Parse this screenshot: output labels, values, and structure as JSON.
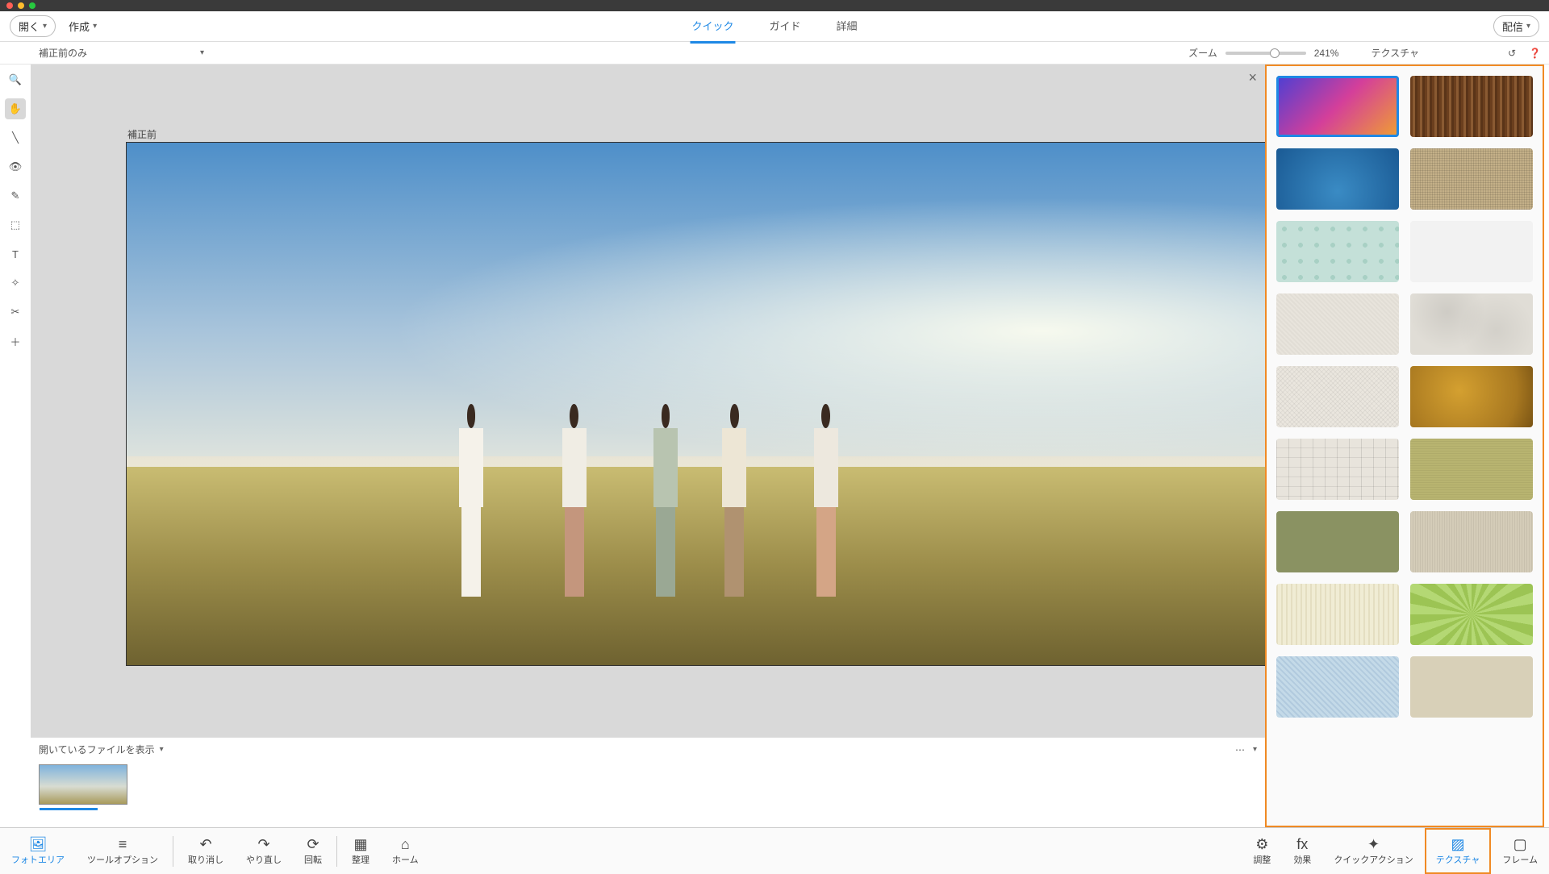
{
  "topbar": {
    "open_label": "開く",
    "create_label": "作成",
    "tabs": {
      "quick": "クイック",
      "guide": "ガイド",
      "detail": "詳細"
    },
    "share_label": "配信"
  },
  "secondbar": {
    "view_mode": "補正前のみ",
    "zoom_label": "ズーム",
    "zoom_value": "241%",
    "panel_title": "テクスチャ"
  },
  "canvas": {
    "before_label": "補正前"
  },
  "left_tools": [
    {
      "name": "zoom-tool",
      "glyph": "🔍"
    },
    {
      "name": "hand-tool",
      "glyph": "✋",
      "active": true
    },
    {
      "name": "quick-select-tool",
      "glyph": "╲"
    },
    {
      "name": "eye-tool",
      "glyph": "👁"
    },
    {
      "name": "brush-tool",
      "glyph": "✎"
    },
    {
      "name": "stamp-tool",
      "glyph": "⬚"
    },
    {
      "name": "text-tool",
      "glyph": "T"
    },
    {
      "name": "heal-tool",
      "glyph": "✧"
    },
    {
      "name": "crop-tool",
      "glyph": "✂"
    },
    {
      "name": "add-tool",
      "glyph": "＋"
    }
  ],
  "textures": [
    {
      "name": "texture-gradient",
      "cls": "tx-gradient",
      "selected": true
    },
    {
      "name": "texture-wood",
      "cls": "tx-wood"
    },
    {
      "name": "texture-blue-cloud",
      "cls": "tx-bluecloud"
    },
    {
      "name": "texture-burlap",
      "cls": "tx-burlap"
    },
    {
      "name": "texture-mint-leaf",
      "cls": "tx-mintleaf"
    },
    {
      "name": "texture-white",
      "cls": "tx-white1"
    },
    {
      "name": "texture-paper",
      "cls": "tx-paper1"
    },
    {
      "name": "texture-crumpled",
      "cls": "tx-crumple"
    },
    {
      "name": "texture-canvas",
      "cls": "tx-canvas"
    },
    {
      "name": "texture-gold",
      "cls": "tx-gold"
    },
    {
      "name": "texture-crackle",
      "cls": "tx-crackle"
    },
    {
      "name": "texture-olive",
      "cls": "tx-olive"
    },
    {
      "name": "texture-sage",
      "cls": "tx-sage"
    },
    {
      "name": "texture-linen",
      "cls": "tx-linen"
    },
    {
      "name": "texture-cream-stripe",
      "cls": "tx-cream"
    },
    {
      "name": "texture-green-burst",
      "cls": "tx-greenburst"
    },
    {
      "name": "texture-blue-weave",
      "cls": "tx-blue2"
    },
    {
      "name": "texture-extra",
      "cls": "tx-extra"
    }
  ],
  "photobin": {
    "header": "開いているファイルを表示"
  },
  "bottombar": {
    "left": [
      {
        "name": "photo-area",
        "label": "フォトエリア",
        "glyph": "🖼",
        "active": true
      },
      {
        "name": "tool-options",
        "label": "ツールオプション",
        "glyph": "≡"
      }
    ],
    "mid": [
      {
        "name": "undo",
        "label": "取り消し",
        "glyph": "↶"
      },
      {
        "name": "redo",
        "label": "やり直し",
        "glyph": "↷"
      },
      {
        "name": "rotate",
        "label": "回転",
        "glyph": "⟳"
      }
    ],
    "mid2": [
      {
        "name": "organize",
        "label": "整理",
        "glyph": "▦"
      },
      {
        "name": "home",
        "label": "ホーム",
        "glyph": "⌂"
      }
    ],
    "right": [
      {
        "name": "adjust",
        "label": "調整",
        "glyph": "⚙"
      },
      {
        "name": "effects",
        "label": "効果",
        "glyph": "fx"
      },
      {
        "name": "quick-actions",
        "label": "クイックアクション",
        "glyph": "✦"
      },
      {
        "name": "textures",
        "label": "テクスチャ",
        "glyph": "▨",
        "highlight": true,
        "active": true
      },
      {
        "name": "frames",
        "label": "フレーム",
        "glyph": "▢"
      }
    ]
  }
}
